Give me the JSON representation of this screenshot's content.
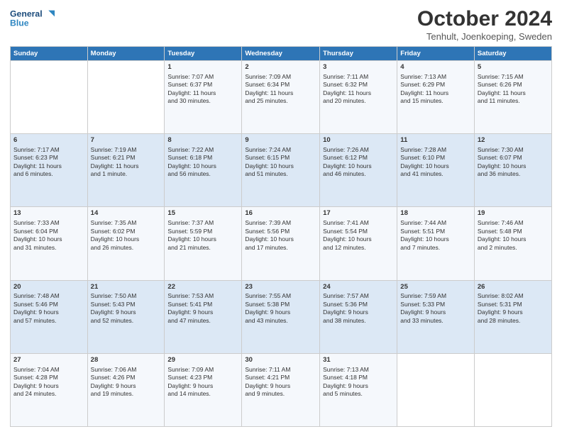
{
  "logo": {
    "line1": "General",
    "line2": "Blue"
  },
  "title": "October 2024",
  "subtitle": "Tenhult, Joenkoeping, Sweden",
  "headers": [
    "Sunday",
    "Monday",
    "Tuesday",
    "Wednesday",
    "Thursday",
    "Friday",
    "Saturday"
  ],
  "weeks": [
    [
      {
        "day": "",
        "info": ""
      },
      {
        "day": "",
        "info": ""
      },
      {
        "day": "1",
        "info": "Sunrise: 7:07 AM\nSunset: 6:37 PM\nDaylight: 11 hours\nand 30 minutes."
      },
      {
        "day": "2",
        "info": "Sunrise: 7:09 AM\nSunset: 6:34 PM\nDaylight: 11 hours\nand 25 minutes."
      },
      {
        "day": "3",
        "info": "Sunrise: 7:11 AM\nSunset: 6:32 PM\nDaylight: 11 hours\nand 20 minutes."
      },
      {
        "day": "4",
        "info": "Sunrise: 7:13 AM\nSunset: 6:29 PM\nDaylight: 11 hours\nand 15 minutes."
      },
      {
        "day": "5",
        "info": "Sunrise: 7:15 AM\nSunset: 6:26 PM\nDaylight: 11 hours\nand 11 minutes."
      }
    ],
    [
      {
        "day": "6",
        "info": "Sunrise: 7:17 AM\nSunset: 6:23 PM\nDaylight: 11 hours\nand 6 minutes."
      },
      {
        "day": "7",
        "info": "Sunrise: 7:19 AM\nSunset: 6:21 PM\nDaylight: 11 hours\nand 1 minute."
      },
      {
        "day": "8",
        "info": "Sunrise: 7:22 AM\nSunset: 6:18 PM\nDaylight: 10 hours\nand 56 minutes."
      },
      {
        "day": "9",
        "info": "Sunrise: 7:24 AM\nSunset: 6:15 PM\nDaylight: 10 hours\nand 51 minutes."
      },
      {
        "day": "10",
        "info": "Sunrise: 7:26 AM\nSunset: 6:12 PM\nDaylight: 10 hours\nand 46 minutes."
      },
      {
        "day": "11",
        "info": "Sunrise: 7:28 AM\nSunset: 6:10 PM\nDaylight: 10 hours\nand 41 minutes."
      },
      {
        "day": "12",
        "info": "Sunrise: 7:30 AM\nSunset: 6:07 PM\nDaylight: 10 hours\nand 36 minutes."
      }
    ],
    [
      {
        "day": "13",
        "info": "Sunrise: 7:33 AM\nSunset: 6:04 PM\nDaylight: 10 hours\nand 31 minutes."
      },
      {
        "day": "14",
        "info": "Sunrise: 7:35 AM\nSunset: 6:02 PM\nDaylight: 10 hours\nand 26 minutes."
      },
      {
        "day": "15",
        "info": "Sunrise: 7:37 AM\nSunset: 5:59 PM\nDaylight: 10 hours\nand 21 minutes."
      },
      {
        "day": "16",
        "info": "Sunrise: 7:39 AM\nSunset: 5:56 PM\nDaylight: 10 hours\nand 17 minutes."
      },
      {
        "day": "17",
        "info": "Sunrise: 7:41 AM\nSunset: 5:54 PM\nDaylight: 10 hours\nand 12 minutes."
      },
      {
        "day": "18",
        "info": "Sunrise: 7:44 AM\nSunset: 5:51 PM\nDaylight: 10 hours\nand 7 minutes."
      },
      {
        "day": "19",
        "info": "Sunrise: 7:46 AM\nSunset: 5:48 PM\nDaylight: 10 hours\nand 2 minutes."
      }
    ],
    [
      {
        "day": "20",
        "info": "Sunrise: 7:48 AM\nSunset: 5:46 PM\nDaylight: 9 hours\nand 57 minutes."
      },
      {
        "day": "21",
        "info": "Sunrise: 7:50 AM\nSunset: 5:43 PM\nDaylight: 9 hours\nand 52 minutes."
      },
      {
        "day": "22",
        "info": "Sunrise: 7:53 AM\nSunset: 5:41 PM\nDaylight: 9 hours\nand 47 minutes."
      },
      {
        "day": "23",
        "info": "Sunrise: 7:55 AM\nSunset: 5:38 PM\nDaylight: 9 hours\nand 43 minutes."
      },
      {
        "day": "24",
        "info": "Sunrise: 7:57 AM\nSunset: 5:36 PM\nDaylight: 9 hours\nand 38 minutes."
      },
      {
        "day": "25",
        "info": "Sunrise: 7:59 AM\nSunset: 5:33 PM\nDaylight: 9 hours\nand 33 minutes."
      },
      {
        "day": "26",
        "info": "Sunrise: 8:02 AM\nSunset: 5:31 PM\nDaylight: 9 hours\nand 28 minutes."
      }
    ],
    [
      {
        "day": "27",
        "info": "Sunrise: 7:04 AM\nSunset: 4:28 PM\nDaylight: 9 hours\nand 24 minutes."
      },
      {
        "day": "28",
        "info": "Sunrise: 7:06 AM\nSunset: 4:26 PM\nDaylight: 9 hours\nand 19 minutes."
      },
      {
        "day": "29",
        "info": "Sunrise: 7:09 AM\nSunset: 4:23 PM\nDaylight: 9 hours\nand 14 minutes."
      },
      {
        "day": "30",
        "info": "Sunrise: 7:11 AM\nSunset: 4:21 PM\nDaylight: 9 hours\nand 9 minutes."
      },
      {
        "day": "31",
        "info": "Sunrise: 7:13 AM\nSunset: 4:18 PM\nDaylight: 9 hours\nand 5 minutes."
      },
      {
        "day": "",
        "info": ""
      },
      {
        "day": "",
        "info": ""
      }
    ]
  ]
}
